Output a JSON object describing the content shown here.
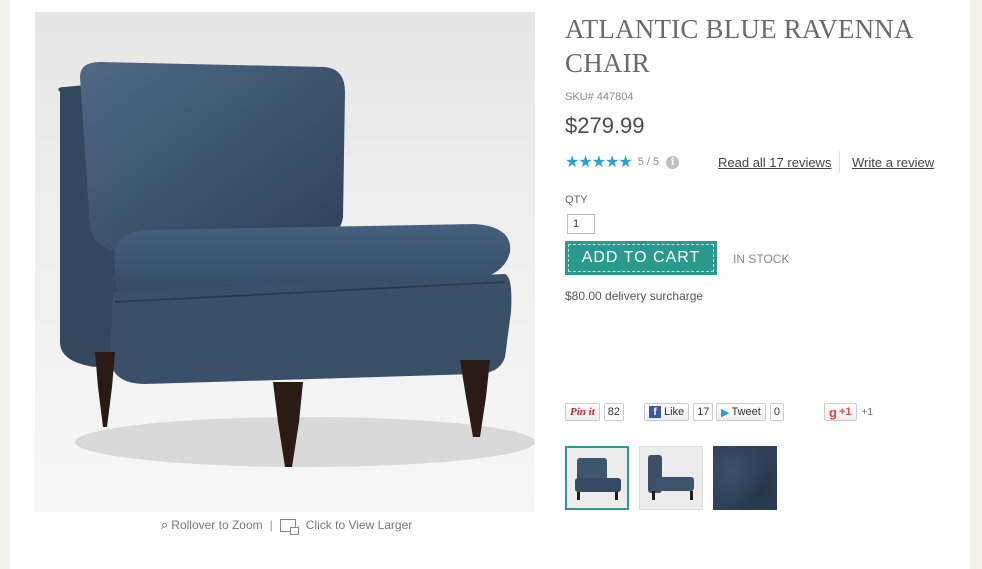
{
  "product": {
    "title": "ATLANTIC BLUE RAVENNA CHAIR",
    "sku": "SKU# 447804",
    "price": "$279.99",
    "rating": {
      "stars": 5,
      "score": "5 / 5"
    },
    "read_reviews": "Read all 17 reviews",
    "write_review": "Write a review",
    "qty_label": "QTY",
    "qty_value": "1",
    "add_to_cart": "ADD TO CART",
    "stock_status": "IN STOCK",
    "delivery_note": "$80.00 delivery surcharge"
  },
  "image_tools": {
    "zoom_label": "Rollover to Zoom",
    "separator": "|",
    "view_larger_label": "Click to View Larger"
  },
  "social": {
    "pinterest": {
      "label": "Pin it",
      "count": "82"
    },
    "facebook": {
      "label": "Like",
      "count": "17"
    },
    "twitter": {
      "label": "Tweet",
      "count": "0"
    },
    "gplus": {
      "label": "+1",
      "count": "+1"
    }
  },
  "colors": {
    "accent": "#2a9a8e",
    "stars": "#2aa1cf",
    "chair_fabric": "#3e5570"
  }
}
